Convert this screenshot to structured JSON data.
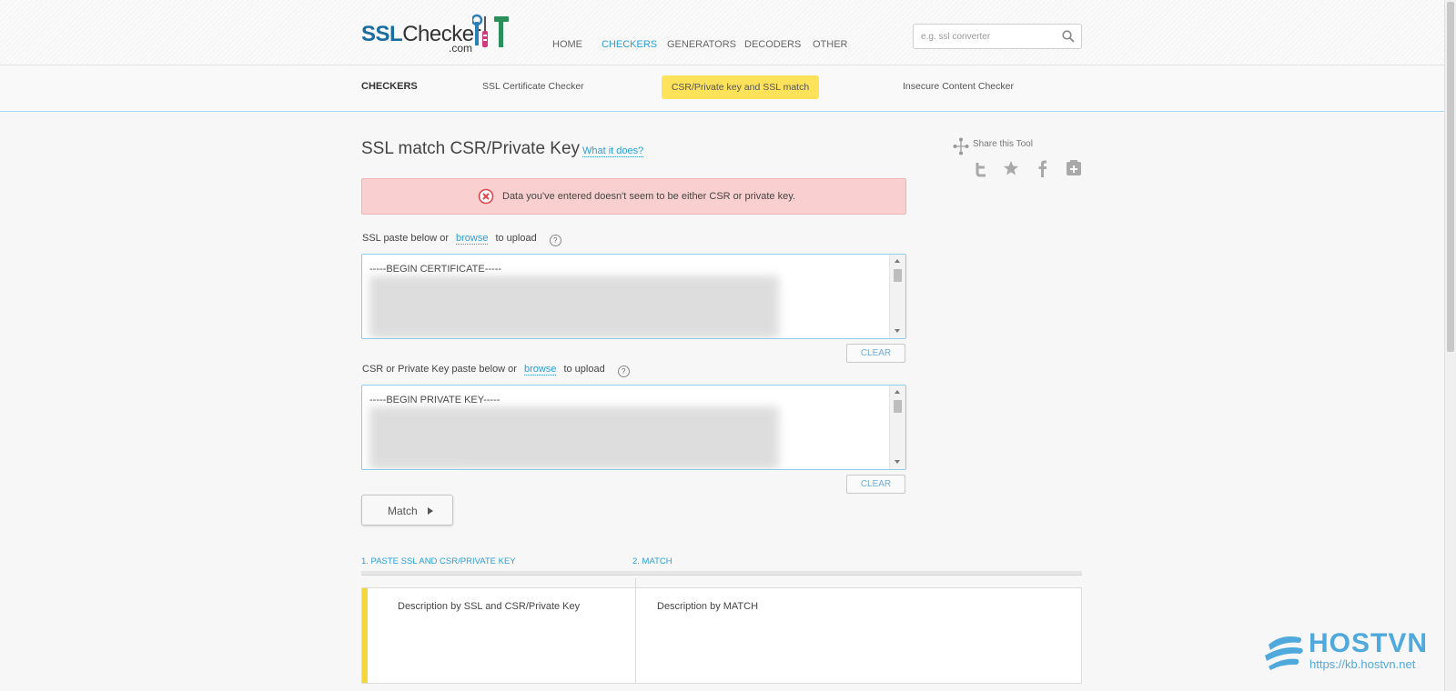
{
  "logo": {
    "part1": "SSL",
    "part2": "Checker",
    "suffix": ".com"
  },
  "nav": {
    "home": "HOME",
    "checkers": "CHECKERS",
    "generators": "GENERATORS",
    "decoders": "DECODERS",
    "other": "OTHER"
  },
  "search": {
    "placeholder": "e.g. ssl converter"
  },
  "subnav": {
    "label": "CHECKERS",
    "items": [
      "SSL Certificate Checker",
      "CSR/Private key and SSL match",
      "Insecure Content Checker"
    ]
  },
  "page": {
    "title": "SSL match CSR/Private Key",
    "what_link": "What it does?"
  },
  "share": {
    "label": "Share this Tool"
  },
  "alert": {
    "message": "Data you've entered doesn't seem to be either CSR or private key."
  },
  "ssl_field": {
    "label_prefix": "SSL paste below or",
    "browse": "browse",
    "label_suffix": "to upload",
    "help": "?",
    "content_head": "-----BEGIN CERTIFICATE-----",
    "clear": "CLEAR"
  },
  "key_field": {
    "label_prefix": "CSR or Private Key paste below or",
    "browse": "browse",
    "label_suffix": "to upload",
    "help": "?",
    "content_head": "-----BEGIN PRIVATE KEY-----",
    "clear": "CLEAR"
  },
  "match_button": "Match",
  "steps": [
    "1. PASTE SSL AND CSR/PRIVATE KEY",
    "2. MATCH"
  ],
  "descriptions": [
    "Description by SSL and CSR/Private Key",
    "Description by MATCH"
  ],
  "watermark": {
    "brand": "HOSTVN",
    "url": "https://kb.hostvn.net"
  },
  "colors": {
    "accent": "#2a9fd6",
    "highlight": "#fde25a",
    "error_bg": "#f9cfd0",
    "error_icon": "#e0464b"
  }
}
